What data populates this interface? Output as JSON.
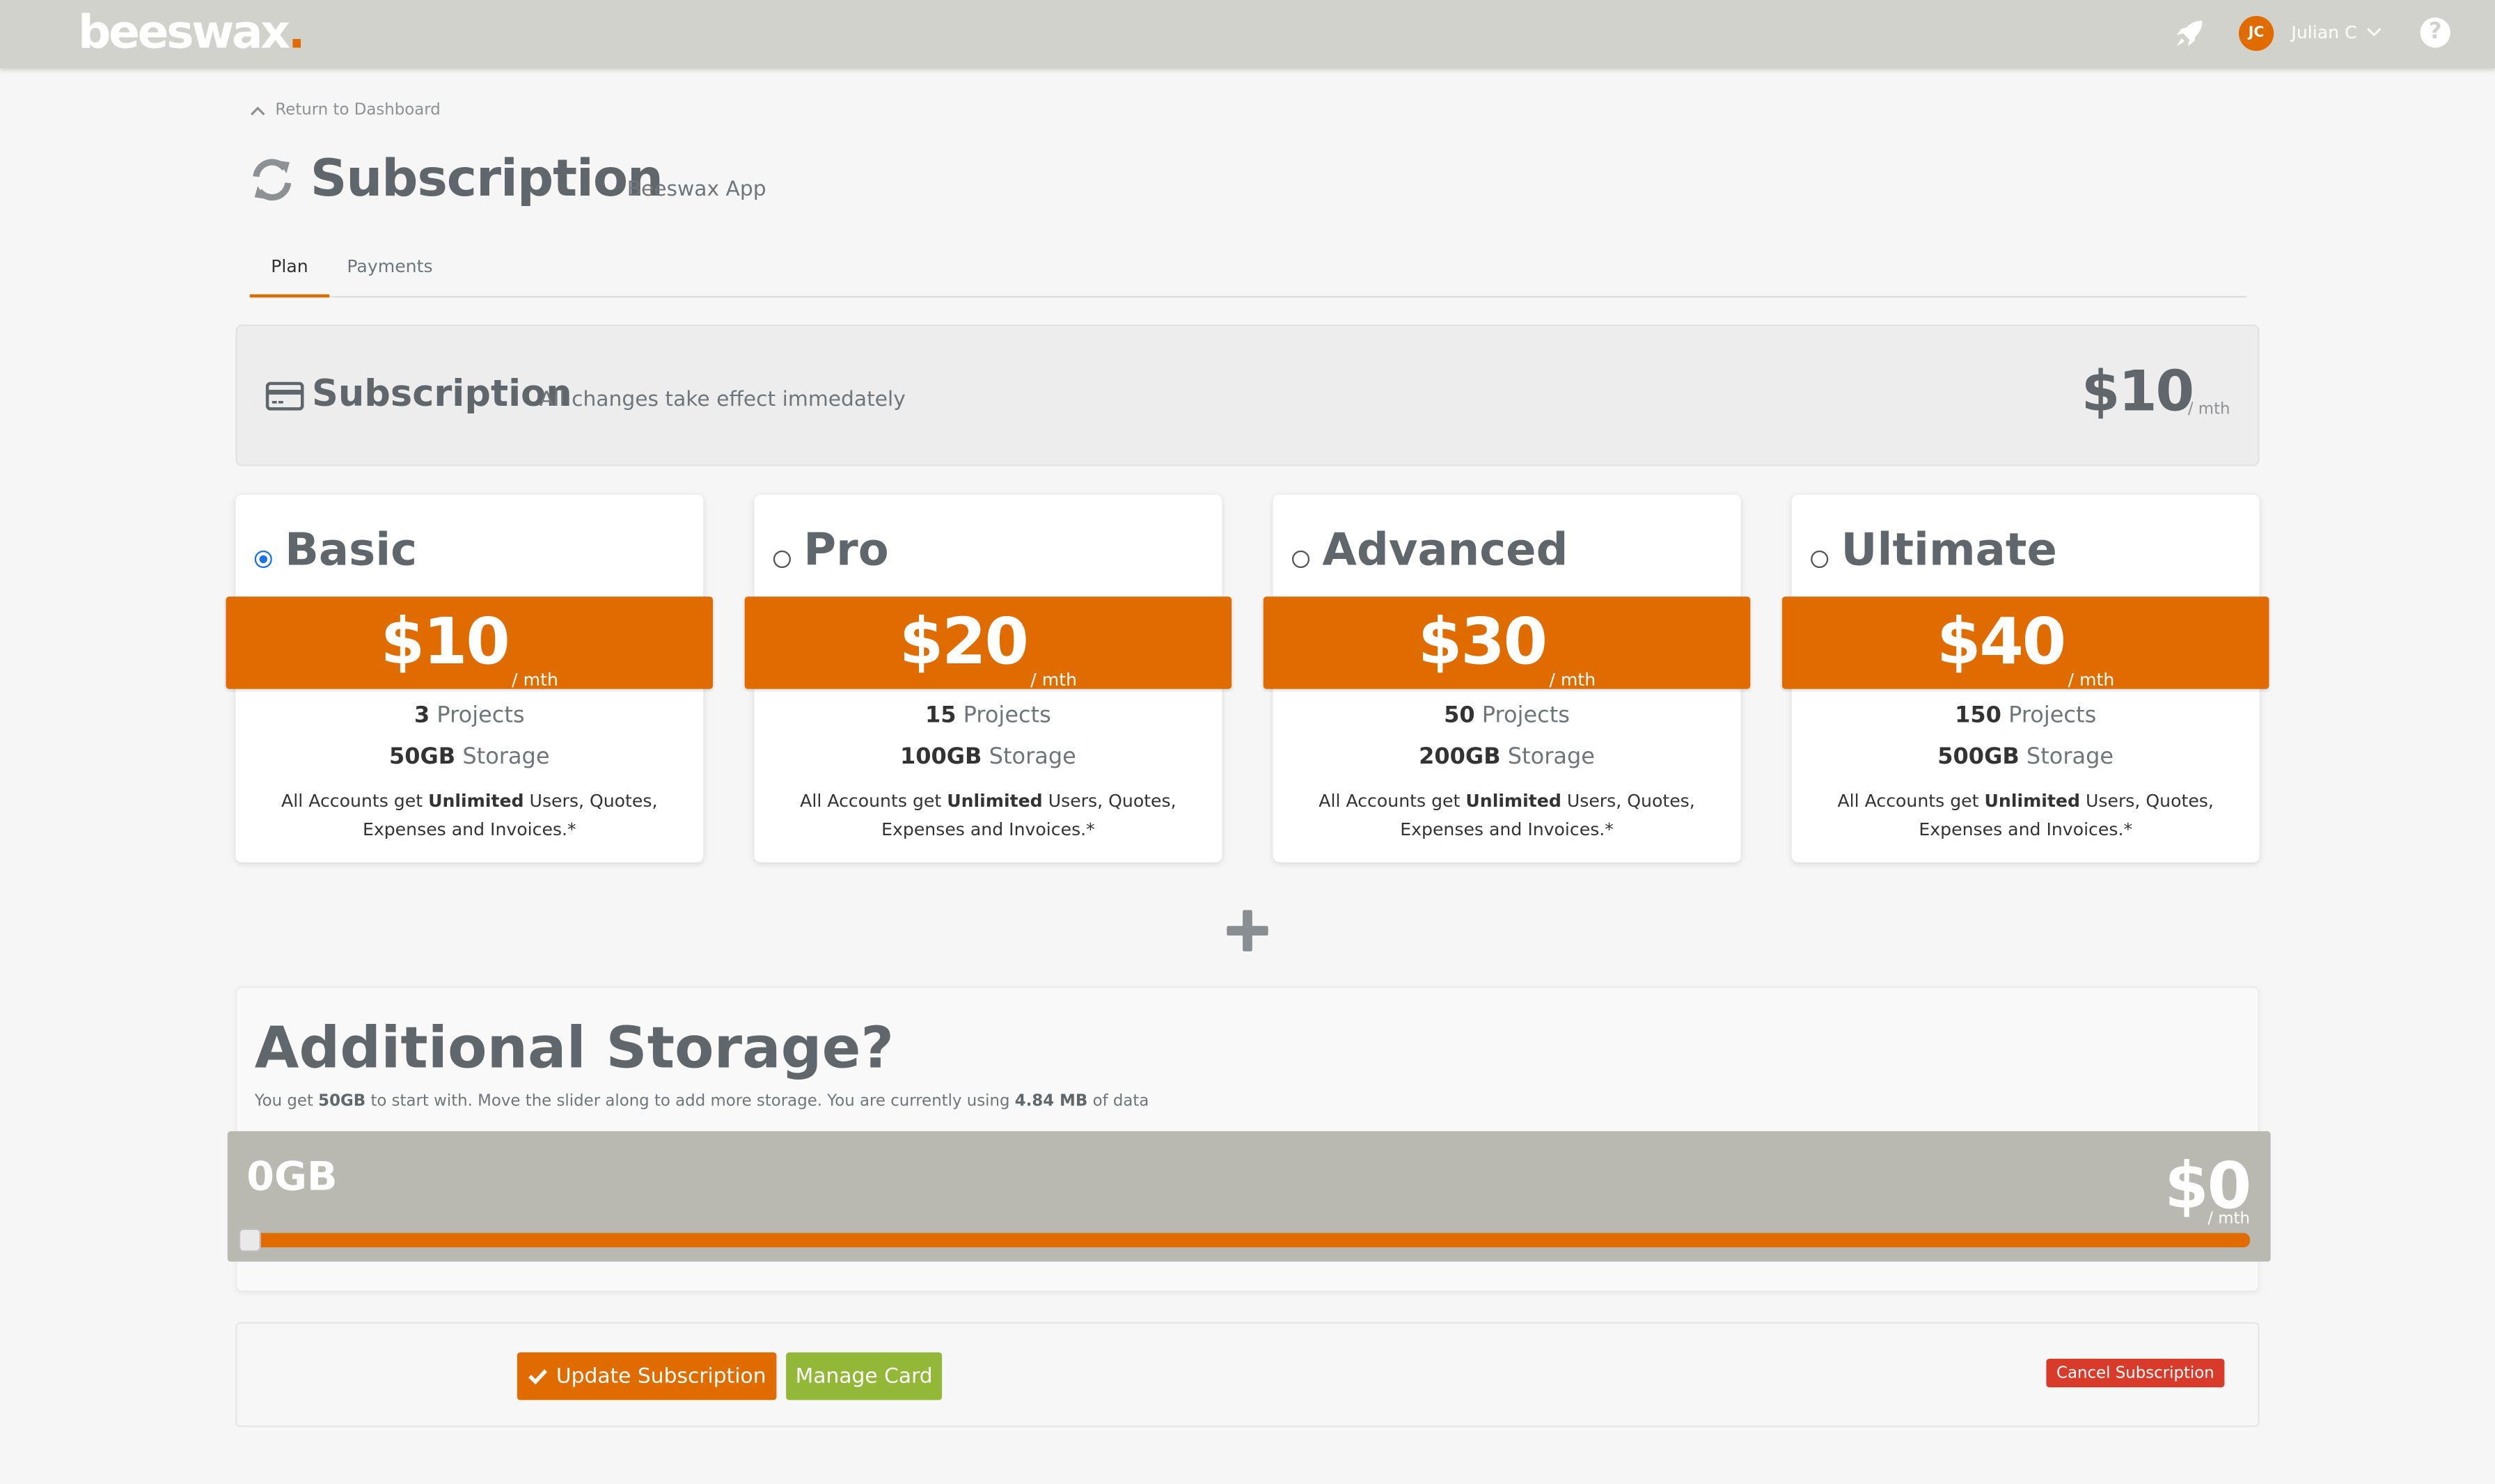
{
  "topbar": {
    "logo_text": "beeswax",
    "logo_dot": ".",
    "avatar_initials": "JC",
    "user_name": "Julian C",
    "help_symbol": "?"
  },
  "nav": {
    "back_label": "Return to Dashboard"
  },
  "page": {
    "title": "Subscription",
    "subtitle": "Beeswax App"
  },
  "tabs": [
    {
      "label": "Plan",
      "active": true
    },
    {
      "label": "Payments",
      "active": false
    }
  ],
  "subscription": {
    "title": "Subscription",
    "note": "All changes take effect immedately",
    "price": "$10",
    "unit": "/ mth"
  },
  "plans": [
    {
      "name": "Basic",
      "price": "$10",
      "unit": "/ mth",
      "projects_num": "3",
      "projects_label": "Projects",
      "storage_num": "50GB",
      "storage_label": "Storage",
      "desc_pre": "All Accounts get ",
      "desc_bold": "Unlimited",
      "desc_post": " Users, Quotes, Expenses and Invoices.*",
      "selected": true
    },
    {
      "name": "Pro",
      "price": "$20",
      "unit": "/ mth",
      "projects_num": "15",
      "projects_label": "Projects",
      "storage_num": "100GB",
      "storage_label": "Storage",
      "desc_pre": "All Accounts get ",
      "desc_bold": "Unlimited",
      "desc_post": " Users, Quotes, Expenses and Invoices.*",
      "selected": false
    },
    {
      "name": "Advanced",
      "price": "$30",
      "unit": "/ mth",
      "projects_num": "50",
      "projects_label": "Projects",
      "storage_num": "200GB",
      "storage_label": "Storage",
      "desc_pre": "All Accounts get ",
      "desc_bold": "Unlimited",
      "desc_post": " Users, Quotes, Expenses and Invoices.*",
      "selected": false
    },
    {
      "name": "Ultimate",
      "price": "$40",
      "unit": "/ mth",
      "projects_num": "150",
      "projects_label": "Projects",
      "storage_num": "500GB",
      "storage_label": "Storage",
      "desc_pre": "All Accounts get ",
      "desc_bold": "Unlimited",
      "desc_post": " Users, Quotes, Expenses and Invoices.*",
      "selected": false
    }
  ],
  "storage": {
    "title": "Additional Storage?",
    "desc_1": "You get ",
    "desc_b1": "50GB",
    "desc_2": " to start with. Move the slider along to add more storage. You are currently using ",
    "desc_b2": "4.84 MB",
    "desc_3": " of data",
    "gb_value": "0GB",
    "price": "$0",
    "unit": "/ mth",
    "slider_fraction": 0
  },
  "actions": {
    "update_label": "Update Subscription",
    "card_label": "Manage Card",
    "cancel_label": "Cancel Subscription"
  },
  "colors": {
    "accent": "#e06c00",
    "topbar": "#d2d2cc",
    "manage_card": "#93b838",
    "cancel": "#d93b2b"
  }
}
